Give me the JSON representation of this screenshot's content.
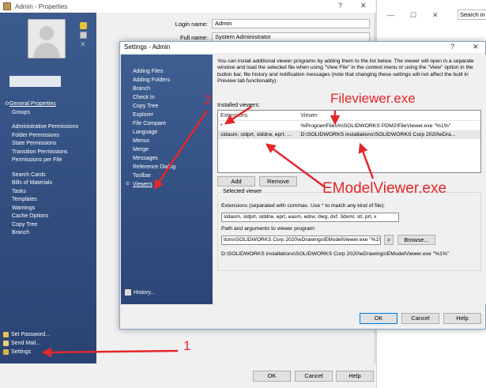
{
  "bg_window": {
    "title": "Admin - Properties",
    "help_ctl": "?",
    "close_ctl": "✕",
    "fields": [
      {
        "label": "Login name:",
        "value": "Admin"
      },
      {
        "label": "Full name:",
        "value": "System Administrator"
      }
    ],
    "nav_items": [
      {
        "label": "General Properties"
      },
      {
        "label": "Groups"
      },
      {
        "label": "Administrative Permissions"
      },
      {
        "label": "Folder Permissions"
      },
      {
        "label": "State Permissions"
      },
      {
        "label": "Transition Permissions"
      },
      {
        "label": "Permissions per File"
      },
      {
        "label": "Search Cards"
      },
      {
        "label": "Bills of Materials"
      },
      {
        "label": "Tasks"
      },
      {
        "label": "Templates"
      },
      {
        "label": "Warnings"
      },
      {
        "label": "Cache Options"
      },
      {
        "label": "Copy Tree"
      },
      {
        "label": "Branch"
      }
    ],
    "bottom_items": [
      {
        "label": "Set Password..."
      },
      {
        "label": "Send Mail..."
      },
      {
        "label": "Settings"
      }
    ],
    "buttons": {
      "ok": "OK",
      "cancel": "Cancel",
      "help": "Help"
    }
  },
  "third_window": {
    "minimize": "—",
    "maximize": "☐",
    "close": "✕",
    "search_text": "Search in C"
  },
  "dialog": {
    "title": "Settings - Admin",
    "help_ctl": "?",
    "close_ctl": "✕",
    "nav_items": [
      {
        "label": "Adding Files"
      },
      {
        "label": "Adding Folders"
      },
      {
        "label": "Branch"
      },
      {
        "label": "Check In"
      },
      {
        "label": "Copy Tree"
      },
      {
        "label": "Explorer"
      },
      {
        "label": "File Compare"
      },
      {
        "label": "Language"
      },
      {
        "label": "Menus"
      },
      {
        "label": "Merge"
      },
      {
        "label": "Messages"
      },
      {
        "label": "Reference Dialog"
      },
      {
        "label": "Toolbar"
      },
      {
        "label": "Viewers",
        "active": true
      }
    ],
    "history_label": "History...",
    "description": "You can install additional viewer programs by adding them to the list below. The viewer will open in a separate window and load the selected file when using \"View File\" in the context menu or using the \"View\" option in the button bar, file history and notification messages (note that changing these settings will not affect the built in Preview tab functionality).",
    "installed_viewers_label": "Installed viewers:",
    "table": {
      "headers": [
        "Extensions",
        "Viewer"
      ],
      "rows": [
        [
          "*",
          "%ProgramFiles%\\SOLIDWORKS PDM2\\FileViewer.exe \"%1%\""
        ],
        [
          "sldasm, sldprt, slddrw, eprt, ...",
          "D:\\SOLIDWORKS installations\\SOLIDWORKS Corp 2020\\eDra..."
        ]
      ]
    },
    "add_button": "Add",
    "remove_button": "Remove",
    "selected_viewer": {
      "legend": "Selected viewer",
      "extensions_label": "Extensions (separated with commas. Use * to match any kind of file):",
      "extensions_value": "sldasm, sldprt, slddrw, eprt, easm, edrw, dwg, dxf, 3dxml, stl, prt, x",
      "path_label": "Path and arguments to viewer program:",
      "path_value": "tions\\SOLIDWORKS Corp 2020\\eDrawings\\EModelViewer.exe \"%1%\"",
      "arrow_button": ">",
      "browse_button": "Browse...",
      "resolved_path": "D:\\SOLIDWORKS installations\\SOLIDWORKS Corp 2020\\eDrawings\\EModelViewer.exe \"%1%\""
    },
    "buttons": {
      "ok": "OK",
      "cancel": "Cancel",
      "help": "Help"
    }
  },
  "annotations": {
    "num1": "1",
    "num2": "2",
    "fileviewer": "Fileviewer.exe",
    "emodelviewer": "EModelViewer.exe",
    "color": "#e5262a"
  }
}
